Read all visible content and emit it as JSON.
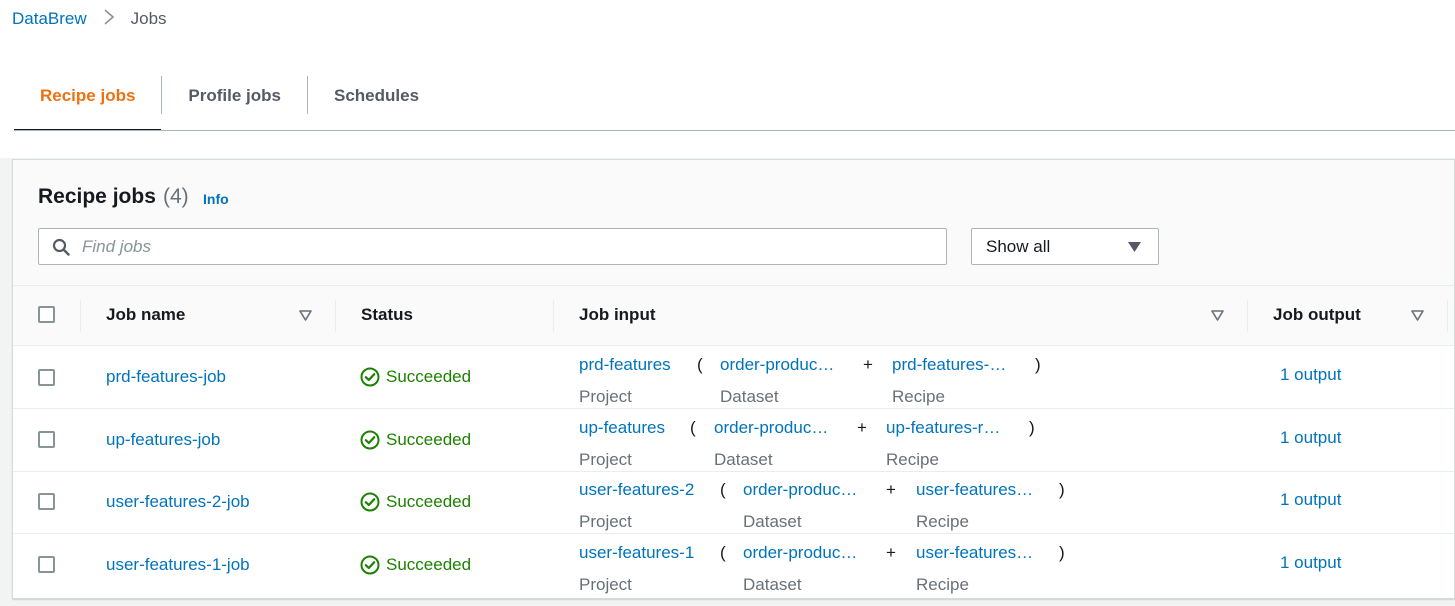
{
  "breadcrumb": {
    "root": "DataBrew",
    "separator": ">",
    "current": "Jobs"
  },
  "tabs": [
    {
      "label": "Recipe jobs",
      "active": true
    },
    {
      "label": "Profile jobs",
      "active": false
    },
    {
      "label": "Schedules",
      "active": false
    }
  ],
  "panel": {
    "title": "Recipe jobs",
    "count": "(4)",
    "info": "Info",
    "search_placeholder": "Find jobs",
    "filter": {
      "selected": "Show all"
    }
  },
  "table": {
    "columns": [
      "Job name",
      "Status",
      "Job input",
      "Job output"
    ],
    "rows": [
      {
        "name": "prd-features-job",
        "status": "Succeeded",
        "input": {
          "project": "prd-features",
          "open": "(",
          "dataset": "order-produc…",
          "plus": "+",
          "recipe": "prd-features-…",
          "close": ")",
          "project_label": "Project",
          "dataset_label": "Dataset",
          "recipe_label": "Recipe"
        },
        "output": "1 output"
      },
      {
        "name": "up-features-job",
        "status": "Succeeded",
        "input": {
          "project": "up-features",
          "open": "(",
          "dataset": "order-produc…",
          "plus": "+",
          "recipe": "up-features-r…",
          "close": ")",
          "project_label": "Project",
          "dataset_label": "Dataset",
          "recipe_label": "Recipe"
        },
        "output": "1 output"
      },
      {
        "name": "user-features-2-job",
        "status": "Succeeded",
        "input": {
          "project": "user-features-2",
          "open": "(",
          "dataset": "order-produc…",
          "plus": "+",
          "recipe": "user-features…",
          "close": ")",
          "project_label": "Project",
          "dataset_label": "Dataset",
          "recipe_label": "Recipe"
        },
        "output": "1 output"
      },
      {
        "name": "user-features-1-job",
        "status": "Succeeded",
        "input": {
          "project": "user-features-1",
          "open": "(",
          "dataset": "order-produc…",
          "plus": "+",
          "recipe": "user-features…",
          "close": ")",
          "project_label": "Project",
          "dataset_label": "Dataset",
          "recipe_label": "Recipe"
        },
        "output": "1 output"
      }
    ]
  },
  "colors": {
    "link": "#0073bb",
    "active_tab": "#ec7211",
    "success": "#1d8102",
    "muted": "#687078"
  },
  "icons": {
    "search": "search-icon",
    "caret": "caret-down-icon",
    "sort": "sort-down-icon",
    "status": "check-circle-icon"
  }
}
